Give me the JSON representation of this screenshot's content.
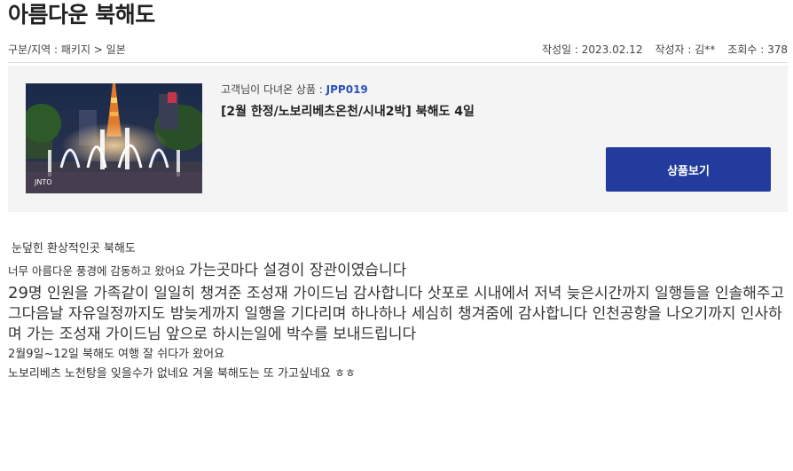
{
  "post": {
    "title": "아름다운 북해도",
    "category_path": "구분/지역 : 패키지 > 일본",
    "date": "작성일 : 2023.02.12",
    "author": "작성자 : 김**",
    "views": "조회수 : 378"
  },
  "product": {
    "ordered_label": "고객님이 다녀온 상품 : ",
    "code": "JPP019",
    "name": "[2월 한정/노보리베츠온천/시내2박] 북해도 4일",
    "view_button": "상품보기",
    "image_watermark": "JNTO"
  },
  "content": {
    "line1": "눈덮힌 환상적인곳 북해도",
    "line2_small": "너무 아름다운 풍경에 감동하고 왔어요 ",
    "line2_big": "가는곳마다 설경이 장관이였습니다",
    "para_lead": "29",
    "para_rest": "명 인원을 가족같이 일일히 챙겨준 조성재 가이드님 감사합니다 삿포로 시내에서 저녁 늦은시간까지 일행들을 인솔해주고  그다음날 자유일정까지도 밤늦게까지 일행을 기다리며 하나하나 세심히 챙겨줌에 감사합니다 인천공항을 나오기까지 인사하며 가는 조성재 가이드님 앞으로 하시는일에 박수를 보내드립니다",
    "line4": "2월9일~12일 북해도 여행 잘 쉬다가 왔어요",
    "line5": "노보리베츠 노천탕을 잊을수가 없네요 겨울 북해도는 또 가고싶네요 ㅎㅎ"
  },
  "colors": {
    "button": "#243b9e",
    "product_code": "#2a52be",
    "box_background": "#f4f4f4"
  }
}
